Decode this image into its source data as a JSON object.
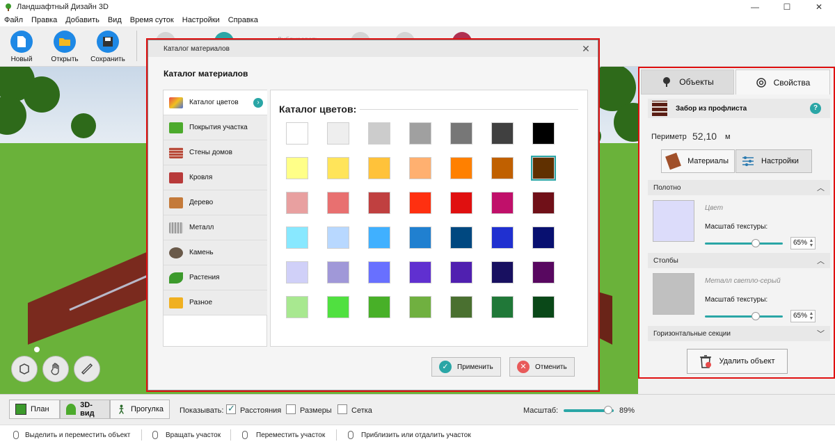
{
  "window": {
    "title": "Ландшафтный Дизайн 3D",
    "min": "—",
    "max": "☐",
    "close": "✕"
  },
  "menu": [
    "Файл",
    "Правка",
    "Добавить",
    "Вид",
    "Время суток",
    "Настройки",
    "Справка"
  ],
  "toolbar": {
    "new_label": "Новый",
    "open_label": "Открыть",
    "save_label": "Сохранить",
    "duplicate_label": "Дублировать"
  },
  "dialog": {
    "window_title": "Каталог материалов",
    "close": "✕",
    "heading": "Каталог материалов",
    "categories": [
      {
        "label": "Каталог цветов",
        "icon": "palette-icon",
        "color": "#4a6fd8"
      },
      {
        "label": "Покрытия участка",
        "icon": "lawn-icon",
        "color": "#4caa2c"
      },
      {
        "label": "Стены домов",
        "icon": "brick-icon",
        "color": "#b84a3a"
      },
      {
        "label": "Кровля",
        "icon": "roof-icon",
        "color": "#b83a3a"
      },
      {
        "label": "Дерево",
        "icon": "wood-icon",
        "color": "#c47a3a"
      },
      {
        "label": "Металл",
        "icon": "metal-icon",
        "color": "#9a9a9a"
      },
      {
        "label": "Камень",
        "icon": "stone-icon",
        "color": "#6a5a4a"
      },
      {
        "label": "Растения",
        "icon": "leaf-icon",
        "color": "#3c9a2c"
      },
      {
        "label": "Разное",
        "icon": "folder-icon",
        "color": "#f0b020"
      }
    ],
    "active_category_arrow": "›",
    "swatch_title": "Каталог цветов:",
    "swatches": [
      [
        "#ffffff",
        "#eeeeee",
        "#cccccc",
        "#a0a0a0",
        "#777777",
        "#404040",
        "#000000"
      ],
      [
        "#ffff88",
        "#ffe45a",
        "#ffc23a",
        "#ffb070",
        "#ff8000",
        "#c06000",
        "#603000"
      ],
      [
        "#e8a0a0",
        "#e87070",
        "#c04040",
        "#ff3010",
        "#e01010",
        "#c0106a",
        "#701018"
      ],
      [
        "#88e8ff",
        "#b8d8ff",
        "#40b0ff",
        "#2080d0",
        "#004880",
        "#2030d0",
        "#081070"
      ],
      [
        "#d0d0f8",
        "#a098d8",
        "#6870ff",
        "#6030d0",
        "#5020b0",
        "#181060",
        "#580860"
      ],
      [
        "#a8e890",
        "#50e040",
        "#48b028",
        "#70b040",
        "#4a7030",
        "#207838",
        "#0a4818"
      ]
    ],
    "selected_swatch": "#603000",
    "apply_label": "Применить",
    "cancel_label": "Отменить"
  },
  "props": {
    "tab_objects": "Объекты",
    "tab_properties": "Свойства",
    "object_name": "Забор из профлиста",
    "help": "?",
    "perimeter_label": "Периметр",
    "perimeter_value": "52,10",
    "perimeter_unit": "м",
    "materials_btn": "Материалы",
    "settings_btn": "Настройки",
    "section1": {
      "title": "Полотно",
      "material": "Цвет",
      "preview_color": "#dcdcfa",
      "scale_label": "Масштаб текстуры:",
      "scale_value": "65%",
      "scale_fraction": 0.65
    },
    "section2": {
      "title": "Столбы",
      "material": "Металл светло-серый",
      "preview_color": "#c0c0c0",
      "scale_label": "Масштаб текстуры:",
      "scale_value": "65%",
      "scale_fraction": 0.65
    },
    "section3_title": "Горизонтальные секции",
    "delete_label": "Удалить объект"
  },
  "viewbar": {
    "plan_label": "План",
    "view3d_label": "3D-вид",
    "walk_label": "Прогулка",
    "show_label": "Показывать:",
    "distances_label": "Расстояния",
    "distances_checked": true,
    "sizes_label": "Размеры",
    "sizes_checked": false,
    "grid_label": "Сетка",
    "grid_checked": false,
    "scale_label": "Масштаб:",
    "scale_value": "89%",
    "scale_fraction": 0.89
  },
  "statusbar": {
    "hint1": "Выделить и переместить объект",
    "hint2": "Вращать участок",
    "hint3": "Переместить участок",
    "hint4": "Приблизить или отдалить участок"
  }
}
